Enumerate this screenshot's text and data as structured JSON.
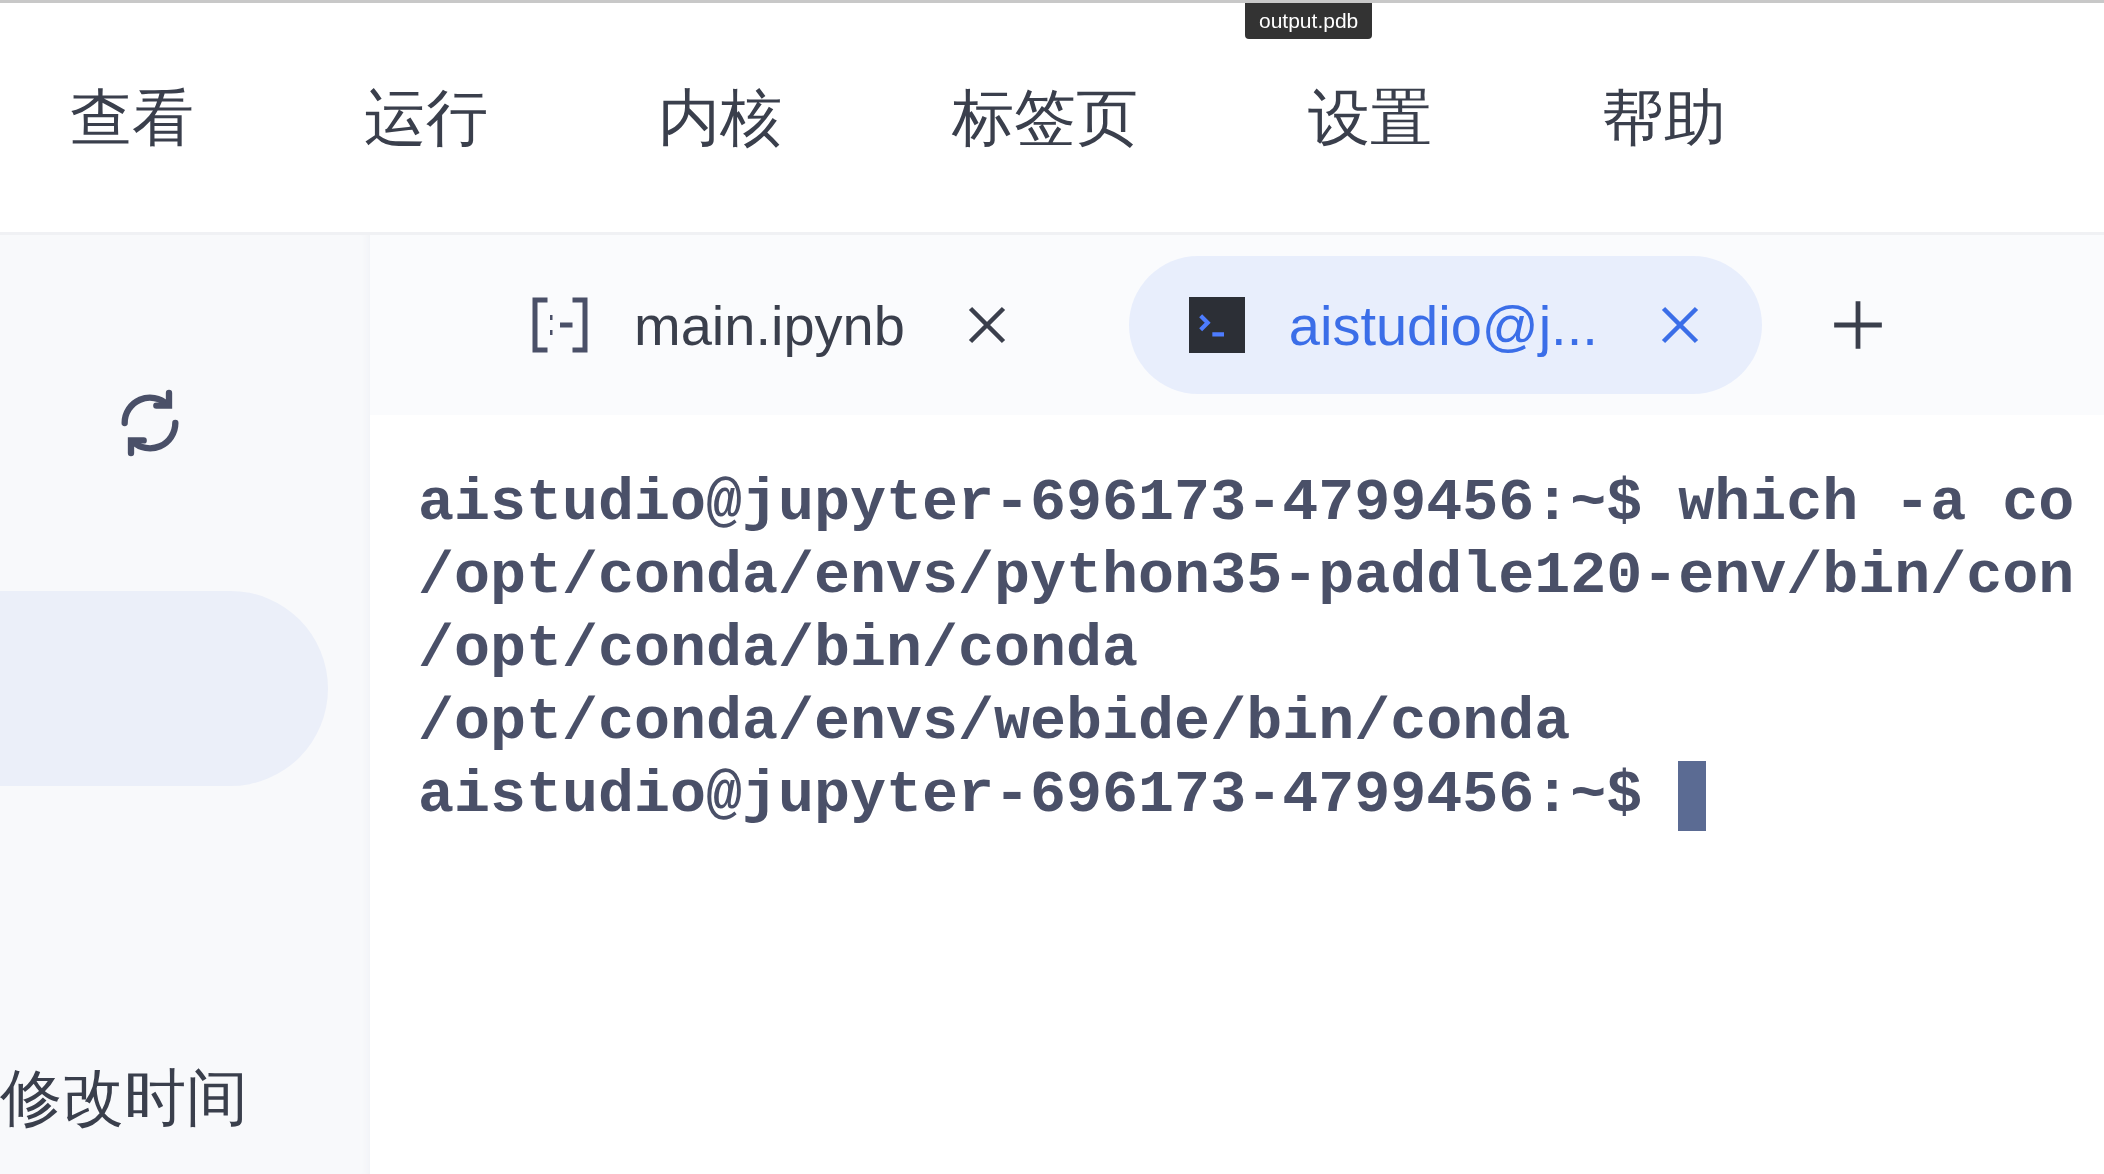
{
  "tooltip": "output.pdb",
  "menu": [
    {
      "label": "查看"
    },
    {
      "label": "运行"
    },
    {
      "label": "内核"
    },
    {
      "label": "标签页"
    },
    {
      "label": "设置"
    },
    {
      "label": "帮助"
    }
  ],
  "sidebar": {
    "highlighted_row": {
      "selected": true
    },
    "column_header": "修改时间"
  },
  "tabs": [
    {
      "label": "main.ipynb",
      "kind": "notebook",
      "selected": false
    },
    {
      "label": "aistudio@j...",
      "kind": "terminal",
      "selected": true
    }
  ],
  "terminal": {
    "lines": [
      "aistudio@jupyter-696173-4799456:~$ which -a co",
      "/opt/conda/envs/python35-paddle120-env/bin/con",
      "/opt/conda/bin/conda",
      "/opt/conda/envs/webide/bin/conda",
      "aistudio@jupyter-696173-4799456:~$ "
    ],
    "cursor": true
  }
}
